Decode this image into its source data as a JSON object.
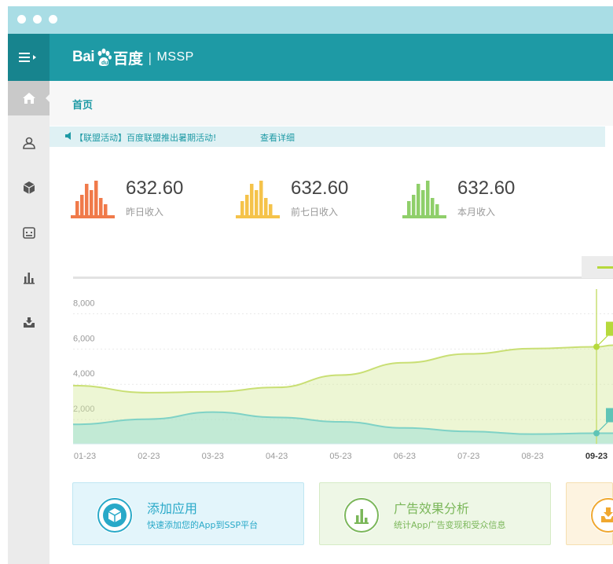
{
  "header": {
    "logo_bai": "Bai",
    "logo_du": "百度",
    "separator": "|",
    "product": "MSSP"
  },
  "breadcrumb": "首页",
  "notice": {
    "text": "【联盟活动】百度联盟推出暑期活动!",
    "link": "查看详细"
  },
  "stats": [
    {
      "value": "632.60",
      "label": "昨日收入",
      "color": "#f07a4a"
    },
    {
      "value": "632.60",
      "label": "前七日收入",
      "color": "#f5c34a"
    },
    {
      "value": "632.60",
      "label": "本月收入",
      "color": "#8fcf6a"
    }
  ],
  "chart_data": {
    "type": "area",
    "x": [
      "01-23",
      "02-23",
      "03-23",
      "04-23",
      "05-23",
      "06-23",
      "07-23",
      "08-23",
      "09-23"
    ],
    "highlight_x": "09-23",
    "y_ticks": [
      "8,000",
      "6,000",
      "4,000",
      "2,000"
    ],
    "ylim": [
      0,
      9000
    ],
    "grid": true,
    "series": [
      {
        "values": [
          3300,
          2900,
          2950,
          3200,
          3900,
          4600,
          5100,
          5400,
          5500
        ],
        "color": "#d7ea9f"
      },
      {
        "values": [
          1100,
          1400,
          1800,
          1500,
          1250,
          900,
          700,
          550,
          600
        ],
        "color": "#9fe0d6"
      }
    ]
  },
  "quick_actions": [
    {
      "title": "添加应用",
      "subtitle": "快速添加您的App到SSP平台",
      "icon": "cube-icon",
      "bg": "#e3f5fb",
      "border": "#bfe6f2",
      "fg": "#29a9c8"
    },
    {
      "title": "广告效果分析",
      "subtitle": "统计App广告变现和受众信息",
      "icon": "bar-chart-icon",
      "bg": "#eef7e6",
      "border": "#d5ebc5",
      "fg": "#7bb75a"
    },
    {
      "title": "",
      "subtitle": "",
      "icon": "download-icon",
      "bg": "#fdf3e0",
      "border": "#f5dfb0",
      "fg": "#f0a830"
    }
  ],
  "sidebar": [
    "home-icon",
    "user-icon",
    "cube-icon",
    "calendar-icon",
    "bar-chart-icon",
    "download-icon"
  ]
}
